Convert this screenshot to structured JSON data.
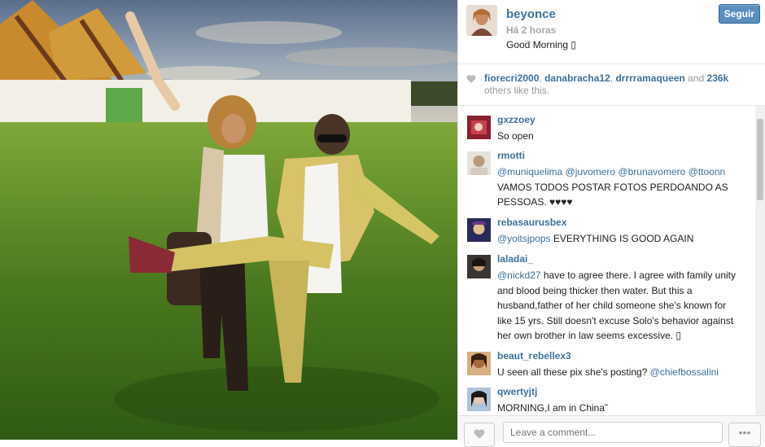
{
  "post": {
    "username": "beyonce",
    "time": "Há 2 horas",
    "caption": "Good Morning ▯",
    "follow_label": "Seguir"
  },
  "likes": {
    "users": [
      "fiorecri2000",
      "danabracha12",
      "drrrramaqueen"
    ],
    "sep1": ", ",
    "sep2": ", ",
    "and_text": " and ",
    "count": "236k",
    "suffix": " others like this."
  },
  "comments": [
    {
      "user": "gxzzoey",
      "parts": [
        {
          "t": "So open",
          "m": false
        }
      ]
    },
    {
      "user": "rmotti",
      "parts": [
        {
          "t": "@muniquelima @juvomero @brunavomero @ttoonn",
          "m": true
        },
        {
          "t": " VAMOS TODOS POSTAR FOTOS PERDOANDO AS PESSOAS. ♥♥♥♥",
          "m": false
        }
      ]
    },
    {
      "user": "rebasaurusbex",
      "parts": [
        {
          "t": "@yoitsjpops",
          "m": true
        },
        {
          "t": " EVERYTHING IS GOOD AGAIN",
          "m": false
        }
      ]
    },
    {
      "user": "laladai_",
      "parts": [
        {
          "t": "@nickd27",
          "m": true
        },
        {
          "t": " have to agree there. I agree with family unity and blood being thicker then water. But this a husband,father of her child someone she's known for like 15 yrs. Still doesn't excuse Solo's behavior against her own brother in law seems excessive. ▯",
          "m": false
        }
      ]
    },
    {
      "user": "beaut_rebellex3",
      "parts": [
        {
          "t": "U seen all these pix she's posting? ",
          "m": false
        },
        {
          "t": "@chiefbossalini",
          "m": true
        }
      ]
    },
    {
      "user": "qwertyjtj",
      "parts": [
        {
          "t": "MORNING,I am in China˜",
          "m": false
        }
      ]
    }
  ],
  "footer": {
    "comment_placeholder": "Leave a comment...",
    "more_label": "•••"
  },
  "icons": {
    "like": "heart-icon",
    "more": "ellipsis-icon"
  },
  "colors": {
    "link": "#3f729b",
    "follow_bg": "#5b8ebc"
  }
}
